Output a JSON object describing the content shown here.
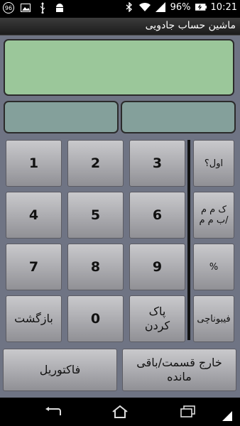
{
  "status_bar": {
    "notification_badge": "96",
    "battery_percent": "96%",
    "time": "10:21"
  },
  "app": {
    "title": "ماشین حساب جادویی"
  },
  "display": {
    "main": "",
    "secondary_left": "",
    "secondary_right": ""
  },
  "keypad": {
    "k1": "1",
    "k2": "2",
    "k3": "3",
    "k4": "4",
    "k5": "5",
    "k6": "6",
    "k7": "7",
    "k8": "8",
    "k9": "9",
    "k0": "0",
    "backspace": "بازگشت",
    "clear": "پاک کردن"
  },
  "functions": {
    "prime": "اول؟",
    "gcd_lcm": "ک م م /ب م م",
    "percent": "%",
    "fibonacci": "فیبوناچی"
  },
  "bottom": {
    "factorial": "فاکتوریل",
    "quotient_remainder": "خارج قسمت/باقی مانده"
  }
}
